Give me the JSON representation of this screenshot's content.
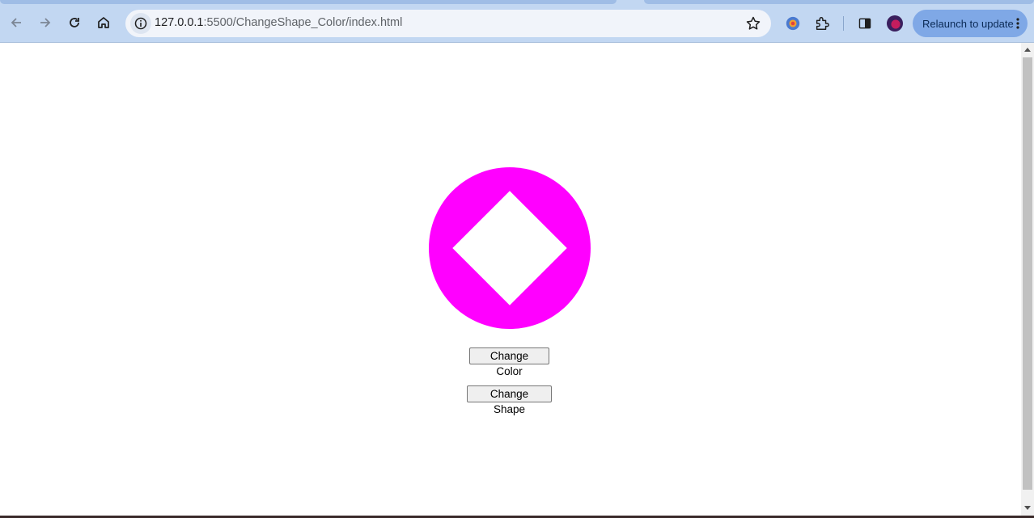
{
  "browser": {
    "url_host": "127.0.0.1",
    "url_path": ":5500/ChangeShape_Color/index.html",
    "relaunch_label": "Relaunch to update",
    "icons": [
      "back-icon",
      "forward-icon",
      "reload-icon",
      "home-icon",
      "site-info-icon",
      "bookmark-star-icon",
      "extension-colorful-icon",
      "extensions-puzzle-icon",
      "side-panel-icon",
      "profile-avatar",
      "kebab-menu-icon"
    ]
  },
  "page": {
    "shape_color": "#ff00ff",
    "inner_shape_color": "#ffffff",
    "buttons": {
      "change_color": "Change Color",
      "change_shape": "Change Shape"
    }
  }
}
